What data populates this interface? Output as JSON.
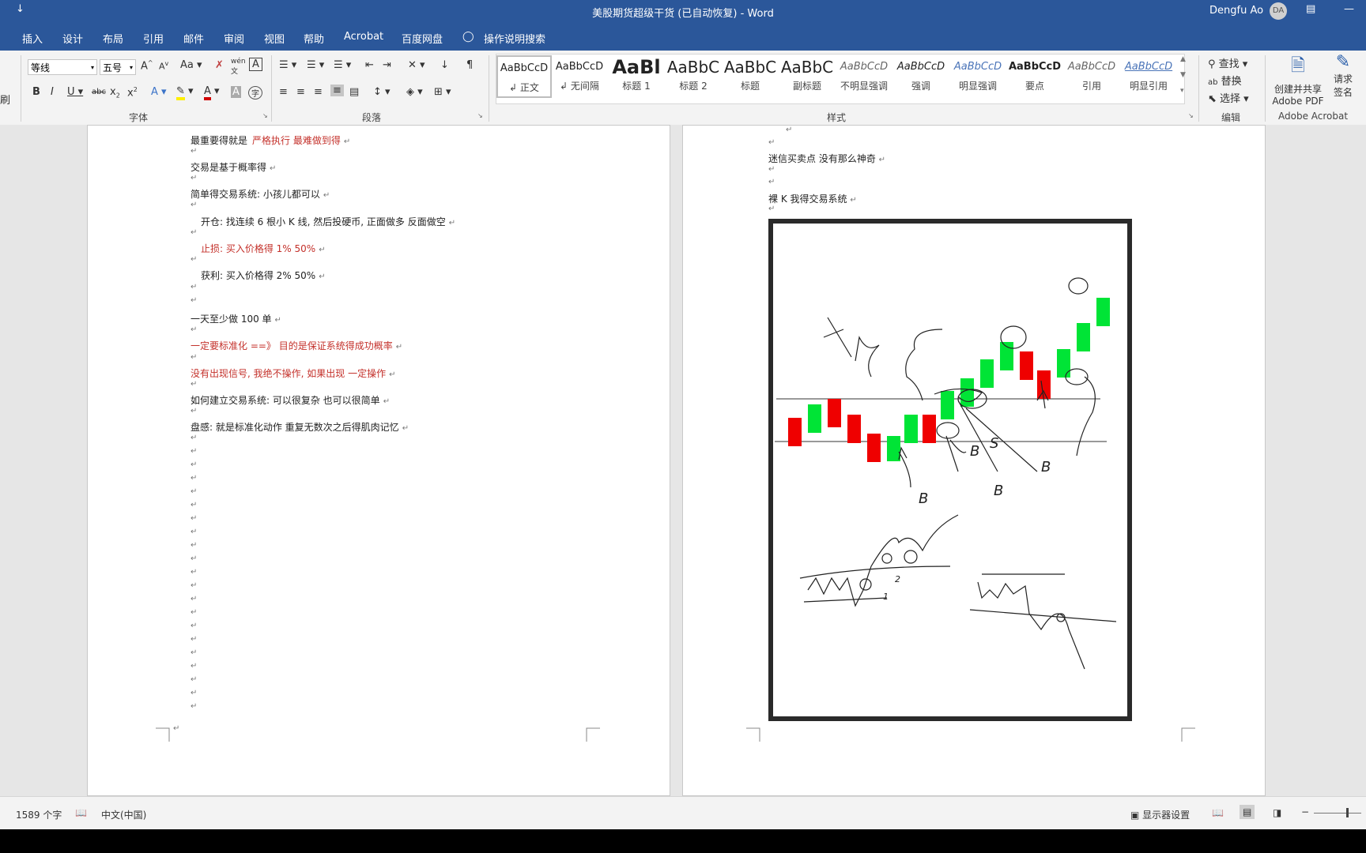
{
  "titlebar": {
    "quick_access": "↓",
    "doc_title": "美股期货超级干货 (已自动恢复)  -  Word",
    "user_name": "Dengfu Ao",
    "avatar_initials": "DA"
  },
  "tabs": [
    "插入",
    "设计",
    "布局",
    "引用",
    "邮件",
    "审阅",
    "视图",
    "帮助",
    "Acrobat",
    "百度网盘"
  ],
  "tell_me": "操作说明搜索",
  "ribbon": {
    "clipboard_label": "刷",
    "font_name": "等线",
    "font_size": "五号",
    "font_group": "字体",
    "paragraph_group": "段落",
    "styles_group": "样式",
    "edit_group": "编辑",
    "adobe_group": "Adobe Acrobat",
    "styles": [
      {
        "sample": "AaBbCcD",
        "name": "正文"
      },
      {
        "sample": "AaBbCcD",
        "name": "无间隔"
      },
      {
        "sample": "AaBl",
        "name": "标题 1"
      },
      {
        "sample": "AaBbC",
        "name": "标题 2"
      },
      {
        "sample": "AaBbC",
        "name": "标题"
      },
      {
        "sample": "AaBbC",
        "name": "副标题"
      },
      {
        "sample": "AaBbCcD",
        "name": "不明显强调"
      },
      {
        "sample": "AaBbCcD",
        "name": "强调"
      },
      {
        "sample": "AaBbCcD",
        "name": "明显强调"
      },
      {
        "sample": "AaBbCcD",
        "name": "要点"
      },
      {
        "sample": "AaBbCcD",
        "name": "引用"
      },
      {
        "sample": "AaBbCcD",
        "name": "明显引用"
      }
    ],
    "find": "查找",
    "replace": "替换",
    "select": "选择",
    "create_pdf_1": "创建并共享",
    "create_pdf_2": "Adobe PDF",
    "request_sign_1": "请求",
    "request_sign_2": "签名"
  },
  "doc_left": {
    "lines": [
      {
        "text": "最重要得就是",
        "red": "严格执行   最难做到得"
      },
      {
        "text": "交易是基于概率得"
      },
      {
        "text": "简单得交易系统:    小孩儿都可以"
      },
      {
        "text": "开仓:    找连续 6 根小 K 线,    然后投硬币,    正面做多  反面做空"
      },
      {
        "red": "止损:      买入价格得 1%    50%"
      },
      {
        "text": "获利:      买入价格得  2%    50%"
      },
      {
        "text": "一天至少做 100 单"
      },
      {
        "red": "一定要标准化  ==》  目的是保证系统得成功概率"
      },
      {
        "red": "没有出现信号,  我绝不操作,  如果出现  一定操作"
      },
      {
        "text": "如何建立交易系统:    可以很复杂  也可以很简单"
      },
      {
        "text": "盘感:  就是标准化动作  重复无数次之后得肌肉记忆"
      }
    ],
    "para_mark": "↵"
  },
  "doc_right": {
    "line1": "迷信买卖点  没有那么神奇",
    "line2": "裸 K  我得交易系统"
  },
  "drawing": {
    "bull_color": "#00e436",
    "bear_color": "#ef0000",
    "labels": [
      "B",
      "B",
      "B",
      "B",
      "S",
      "1",
      "2"
    ]
  },
  "statusbar": {
    "word_count": "1589 个字",
    "language": "中文(中国)",
    "display_settings": "显示器设置"
  }
}
